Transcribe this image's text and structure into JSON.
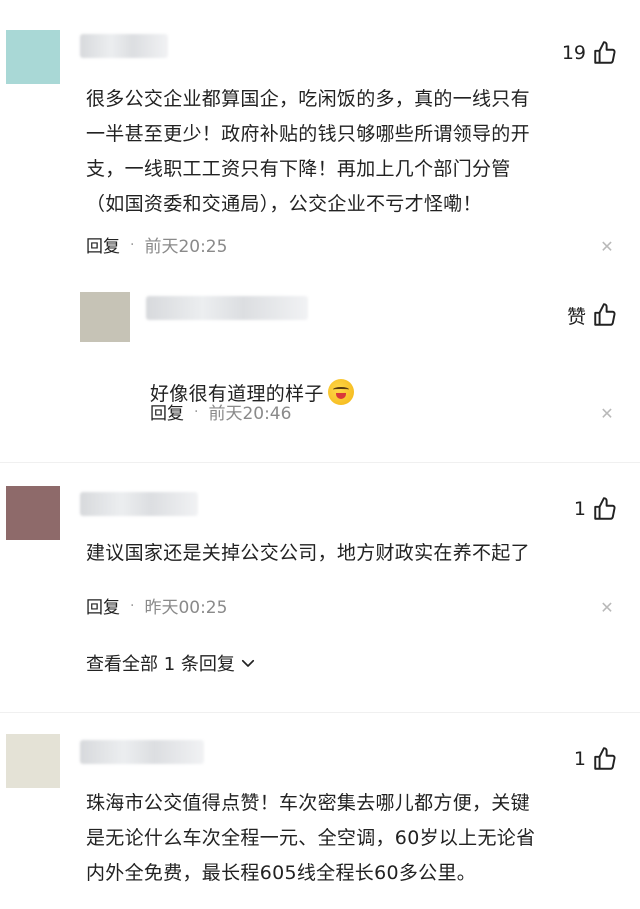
{
  "comments": [
    {
      "avatar_color": "#a9d8d6",
      "likes": "19",
      "text": "很多公交企业都算国企，吃闲饭的多，真的一线只有\n一半甚至更少！政府补贴的钱只够哪些所谓领导的开\n支，一线职工工资只有下降！再加上几个部门分管\n（如国资委和交通局），公交企业不亏才怪嘞！",
      "reply_label": "回复",
      "time": "前天20:25",
      "reply": {
        "avatar_color": "#c6c3b6",
        "likes": "赞",
        "text": "好像很有道理的样子",
        "reply_label": "回复",
        "time": "前天20:46"
      }
    },
    {
      "avatar_color": "#8e6a6a",
      "likes": "1",
      "text": "建议国家还是关掉公交公司，地方财政实在养不起了",
      "reply_label": "回复",
      "time": "昨天00:25",
      "expand_label": "查看全部 1 条回复"
    },
    {
      "avatar_color": "#e4e2d6",
      "likes": "1",
      "text": "珠海市公交值得点赞！车次密集去哪儿都方便，关键\n是无论什么车次全程一元、全空调，60岁以上无论省\n内外全免费，最长程605线全程长60多公里。"
    }
  ],
  "icons": {
    "like": "thumbs-up-icon",
    "close": "close-icon",
    "expand": "chevron-down-icon",
    "emoji": "laughing-emoji-icon"
  }
}
